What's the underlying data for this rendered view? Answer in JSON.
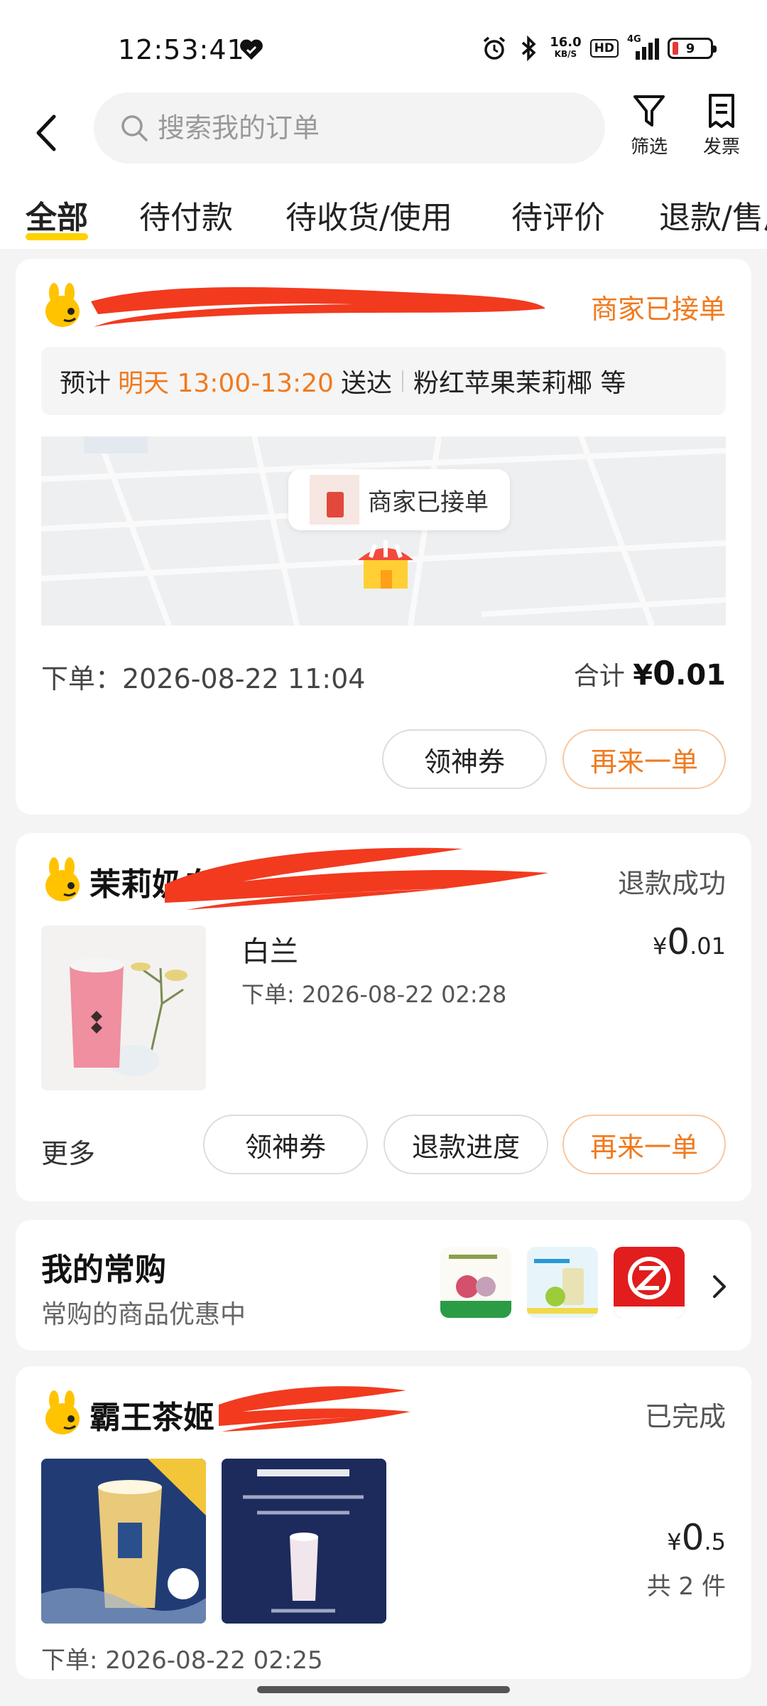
{
  "status_bar": {
    "time": "12:53:41",
    "net_speed_value": "16.0",
    "net_speed_unit": "KB/S",
    "hd_label": "HD",
    "signal_label": "4G",
    "battery_level": "9",
    "icons": [
      "heart-icon",
      "alarm-icon",
      "bluetooth-icon",
      "signal-icon",
      "battery-icon"
    ]
  },
  "header": {
    "search_placeholder": "搜索我的订单",
    "filter_label": "筛选",
    "invoice_label": "发票"
  },
  "tabs": [
    {
      "label": "全部",
      "active": true
    },
    {
      "label": "待付款"
    },
    {
      "label": "待收货/使用"
    },
    {
      "label": "待评价"
    },
    {
      "label": "退款/售后"
    }
  ],
  "orders": [
    {
      "status": "商家已接单",
      "eta_prefix": "预计",
      "eta_time": "明天 13:00-13:20",
      "eta_suffix": "送达",
      "eta_items": "粉红苹果茉莉椰 等",
      "map_bubble": "商家已接单",
      "order_time": "下单：2026-08-22 11:04",
      "total_label": "合计",
      "total_currency": "¥",
      "total_int": "0",
      "total_dec": ".01",
      "btn_coupon": "领神券",
      "btn_reorder": "再来一单"
    },
    {
      "store_name": "茉莉奶白",
      "status": "退款成功",
      "product_name": "白兰",
      "product_date": "下单: 2026-08-22 02:28",
      "price_currency": "¥",
      "price_int": "0",
      "price_dec": ".01",
      "more_label": "更多",
      "btn_coupon": "领神券",
      "btn_refund": "退款进度",
      "btn_reorder": "再来一单"
    },
    {
      "store_name": "霸王茶姬",
      "status": "已完成",
      "price_currency": "¥",
      "price_int": "0",
      "price_dec": ".5",
      "count": "共 2 件",
      "order_time": "下单: 2026-08-22 02:25"
    }
  ],
  "frequent": {
    "title": "我的常购",
    "subtitle": "常购的商品优惠中"
  },
  "colors": {
    "accent_orange": "#f07a1e",
    "tab_underline": "#ffd100",
    "redaction": "#f23a1f"
  }
}
